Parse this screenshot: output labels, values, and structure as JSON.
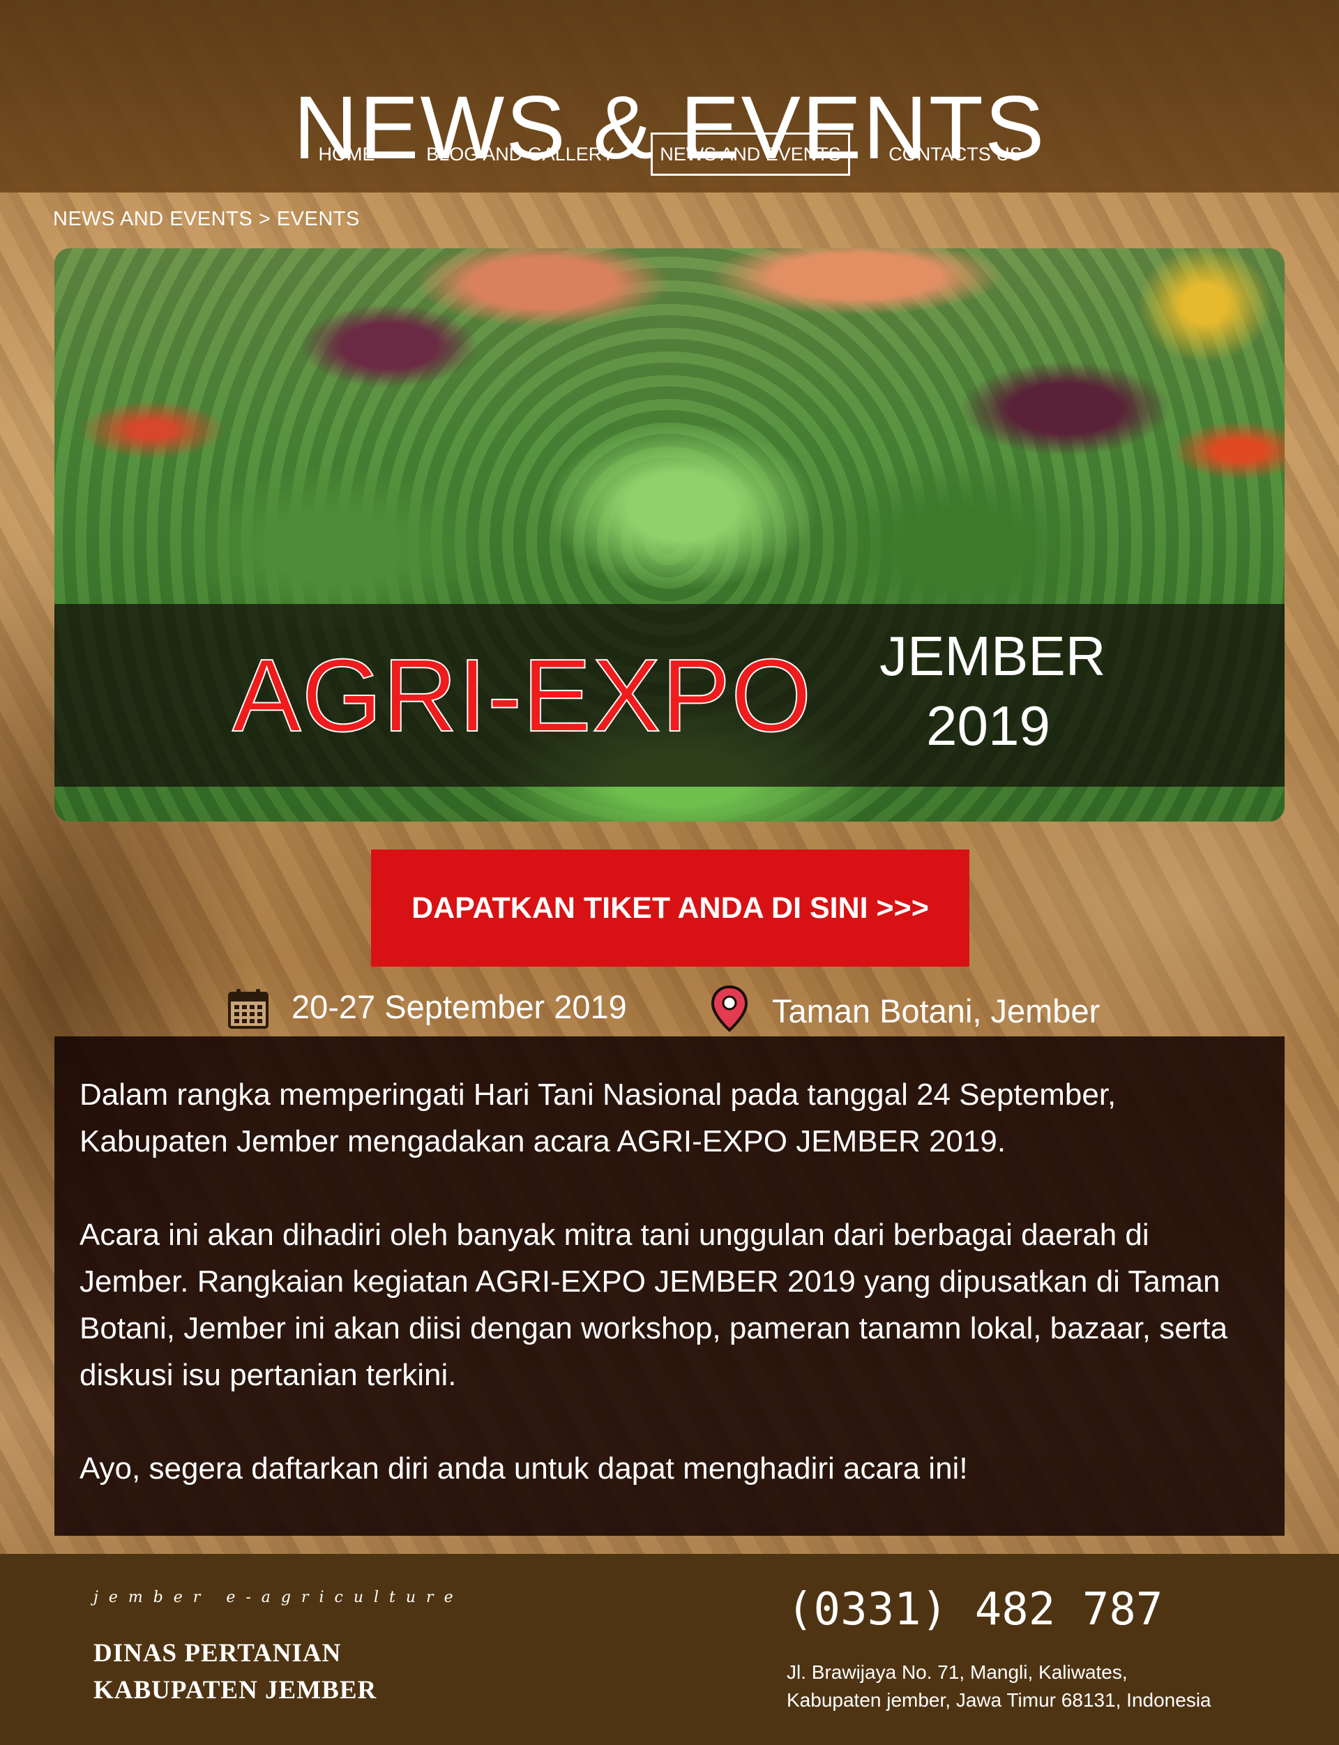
{
  "header": {
    "title": "NEWS & EVENTS",
    "nav": [
      {
        "label": "HOME"
      },
      {
        "label": "BLOG AND GALLERY"
      },
      {
        "label": "NEWS AND EVENTS",
        "active": true
      },
      {
        "label": "CONTACTS US"
      }
    ]
  },
  "breadcrumb": "NEWS AND EVENTS > EVENTS",
  "hero": {
    "title": "AGRI-EXPO",
    "subtitle_line1": "JEMBER",
    "subtitle_line2": "2019"
  },
  "ticket_button": "DAPATKAN TIKET ANDA DI SINI >>>",
  "event": {
    "date": "20-27 September 2019",
    "date_icon": "calendar-icon",
    "location": "Taman Botani, Jember",
    "location_icon": "map-pin-icon"
  },
  "description": {
    "paragraphs": [
      "Dalam rangka memperingati Hari Tani Nasional pada tanggal 24 September, Kabupaten Jember mengadakan acara AGRI-EXPO JEMBER 2019.",
      "Acara ini akan dihadiri oleh banyak mitra tani unggulan dari berbagai daerah di Jember. Rangkaian kegiatan AGRI-EXPO JEMBER 2019 yang dipusatkan di Taman Botani, Jember ini akan diisi dengan workshop, pameran tanamn lokal, bazaar, serta diskusi isu pertanian terkini.",
      "Ayo, segera daftarkan diri anda untuk dapat menghadiri acara ini!"
    ]
  },
  "footer": {
    "tagline": "jember e-agriculture",
    "org_line1": "DINAS PERTANIAN",
    "org_line2": "KABUPATEN JEMBER",
    "phone": "(0331) 482 787",
    "address_line1": "Jl. Brawijaya No. 71, Mangli, Kaliwates,",
    "address_line2": "Kabupaten jember, Jawa Timur 68131, Indonesia"
  },
  "colors": {
    "header_bg": "#5a3812",
    "footer_bg": "#4e3412",
    "ticket_button": "#d81214",
    "hero_title": "#ee1c1c",
    "pin": "#e23b52"
  }
}
